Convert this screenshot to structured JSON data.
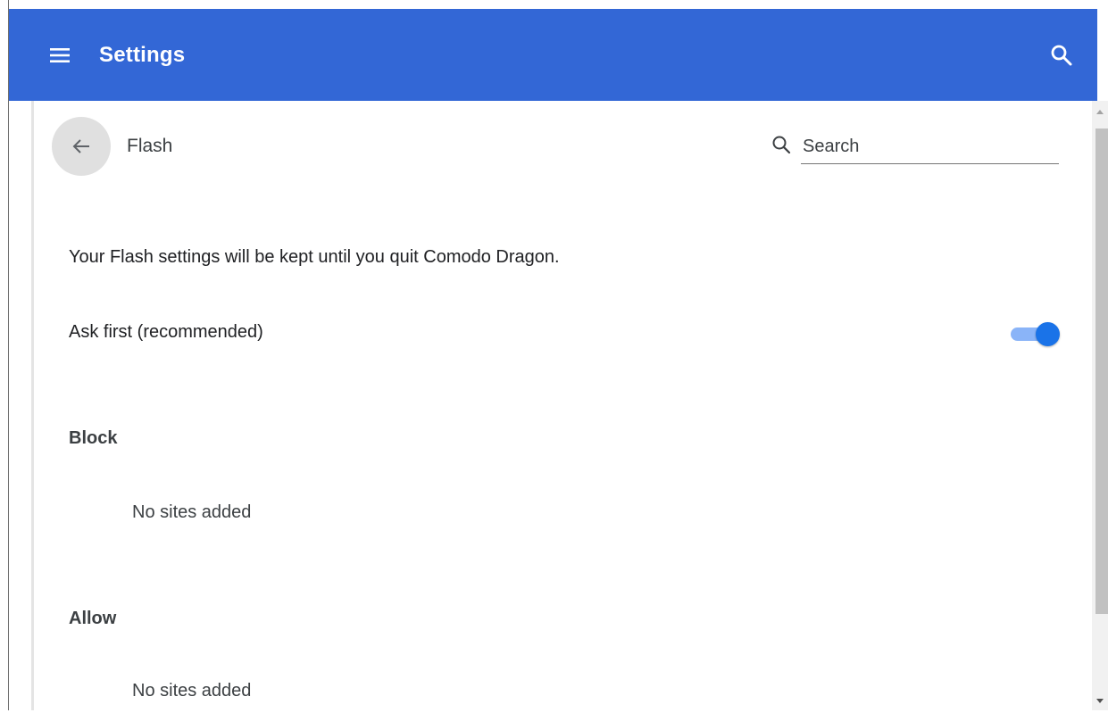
{
  "app": {
    "title": "Settings"
  },
  "header": {
    "menu_icon": "hamburger-menu-icon",
    "search_icon": "search-icon",
    "background_color": "#3367d6"
  },
  "page": {
    "title": "Flash",
    "back_icon": "arrow-back-icon",
    "search": {
      "placeholder": "Search",
      "value": ""
    }
  },
  "settings": {
    "info_text": "Your Flash settings will be kept until you quit Comodo Dragon.",
    "ask_first": {
      "label": "Ask first (recommended)",
      "enabled": true
    },
    "block": {
      "heading": "Block",
      "empty_text": "No sites added"
    },
    "allow": {
      "heading": "Allow",
      "empty_text": "No sites added"
    }
  },
  "colors": {
    "accent": "#1a73e8",
    "toggle_track": "#8ab4f8"
  }
}
